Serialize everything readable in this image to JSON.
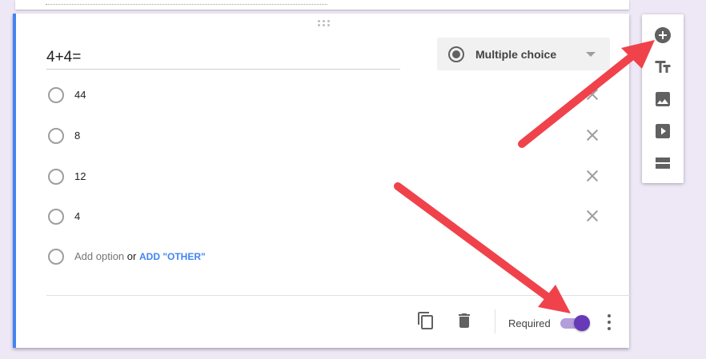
{
  "question": {
    "title": "4+4="
  },
  "question_type": {
    "label": "Multiple choice",
    "icon": "radio-button-icon"
  },
  "options": [
    {
      "label": "44"
    },
    {
      "label": "8"
    },
    {
      "label": "12"
    },
    {
      "label": "4"
    }
  ],
  "add_option": {
    "label": "Add option",
    "or": "or",
    "other": "ADD \"OTHER\""
  },
  "footer": {
    "required_label": "Required",
    "required_on": true
  },
  "toolbar": {
    "items": [
      "add-question-icon",
      "title-text-icon",
      "image-icon",
      "video-icon",
      "section-icon"
    ]
  },
  "colors": {
    "accent": "#673ab7",
    "link": "#4285f4",
    "arrow": "#f0424b"
  }
}
